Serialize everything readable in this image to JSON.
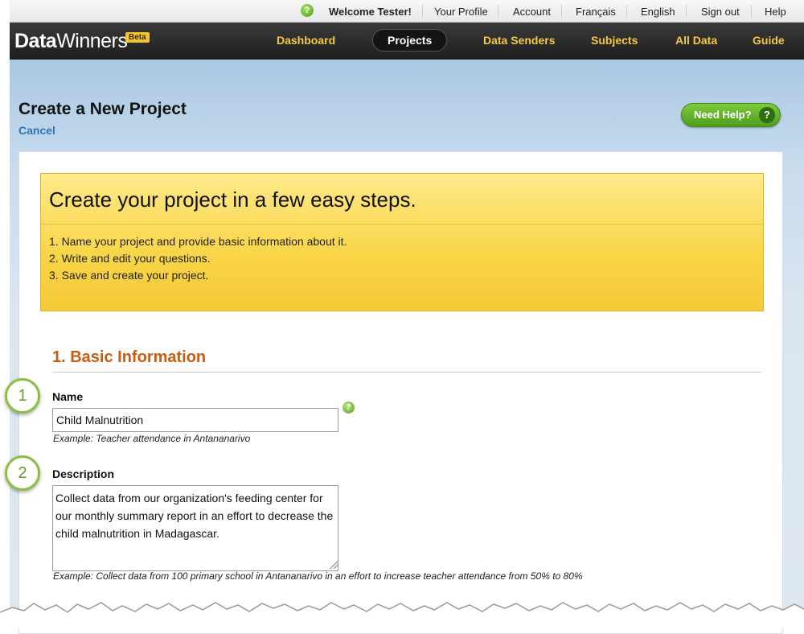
{
  "top_bar": {
    "welcome": "Welcome Tester!",
    "links": [
      "Your Profile",
      "Account",
      "Français",
      "English",
      "Sign out",
      "Help"
    ]
  },
  "brand": {
    "logo_bold": "Data",
    "logo_light": "Winners",
    "badge": "Beta"
  },
  "nav": {
    "items": [
      "Dashboard",
      "Projects",
      "Data Senders",
      "Subjects",
      "All Data",
      "Guide"
    ],
    "active": "Projects"
  },
  "page": {
    "title": "Create a New Project",
    "cancel": "Cancel",
    "need_help": "Need Help?",
    "help_icon_glyph": "?"
  },
  "intro": {
    "heading": "Create your project in a few easy steps.",
    "steps": [
      "1. Name your project and provide basic information about it.",
      "2. Write and edit your questions.",
      "3. Save and create your project."
    ]
  },
  "section": {
    "title": "1. Basic Information"
  },
  "name_field": {
    "label": "Name",
    "value": "Child Malnutrition",
    "example": "Example: Teacher attendance in Antananarivo"
  },
  "description_field": {
    "label": "Description",
    "value": "Collect data from our organization's feeding center for our monthly summary report in an effort to decrease the child malnutrition in Madagascar.",
    "example": "Example: Collect data from 100 primary school in Antananarivo in an effort to increase teacher attendance from 50% to 80%"
  },
  "callouts": [
    "1",
    "2"
  ],
  "colors": {
    "nav_link": "#f6c843",
    "section_title": "#c65d0f",
    "link": "#2f74b5",
    "help_green": "#5aa321"
  }
}
